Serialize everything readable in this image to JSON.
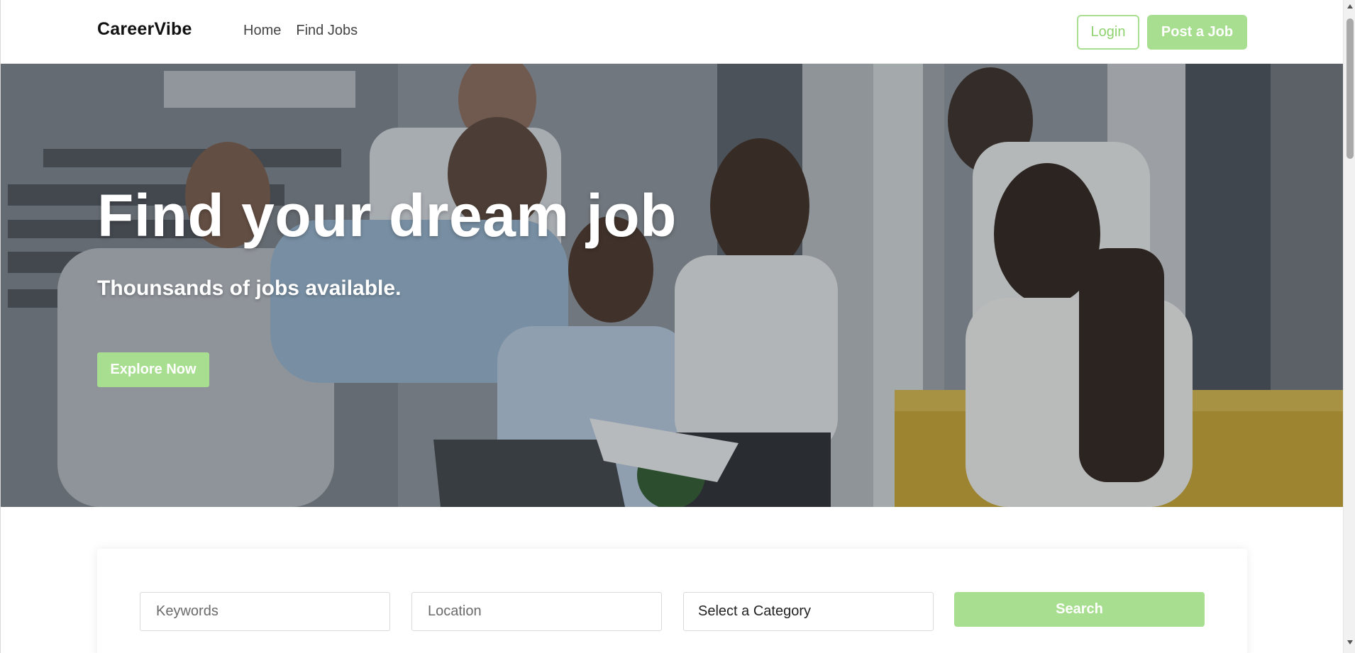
{
  "header": {
    "logo": "CareerVibe",
    "nav": [
      {
        "label": "Home"
      },
      {
        "label": "Find Jobs"
      }
    ],
    "login_label": "Login",
    "post_job_label": "Post a Job"
  },
  "hero": {
    "title": "Find your dream job",
    "subtitle": "Thounsands of jobs available.",
    "cta_label": "Explore Now",
    "image_description_icon": "office-team-photo"
  },
  "search": {
    "keywords_placeholder": "Keywords",
    "location_placeholder": "Location",
    "category_selected": "Select a Category",
    "search_label": "Search"
  },
  "colors": {
    "accent": "#a8de8f",
    "text_dark": "#111111",
    "nav_text": "#444444"
  }
}
